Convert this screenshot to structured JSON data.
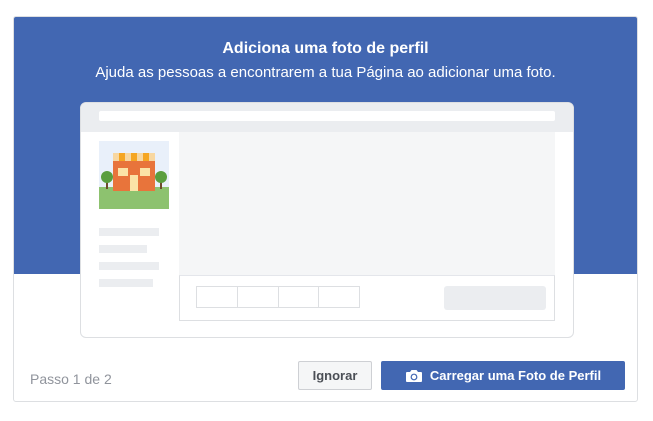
{
  "dialog": {
    "title": "Adiciona uma foto de perfil",
    "subtitle": "Ajuda as pessoas a encontrarem a tua Página ao adicionar uma foto.",
    "step_text": "Passo 1 de 2",
    "skip_label": "Ignorar",
    "upload_label": "Carregar uma Foto de Perfil"
  },
  "illustration": {
    "profile_picture_icon": "storefront-icon",
    "upload_icon": "camera-icon"
  },
  "colors": {
    "brand_blue": "#4267b2",
    "text_muted": "#90949c",
    "placeholder_gray": "#ebedf0"
  }
}
